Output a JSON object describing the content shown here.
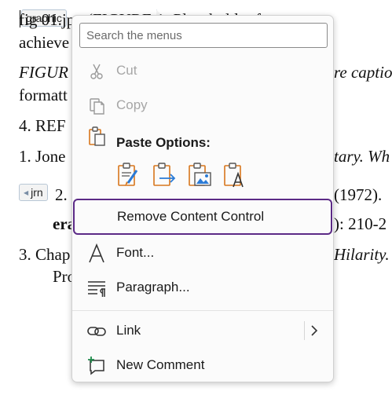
{
  "document": {
    "lines": [
      {
        "id": "l1",
        "text": "          fig 01.jpg  (FIGURE 1: Placeholder for",
        "style": "normal"
      },
      {
        "id": "l2",
        "text": "achieve",
        "style": "normal"
      },
      {
        "id": "l3",
        "text": "FIGUR",
        "style": "italic",
        "tail": "re captio"
      },
      {
        "id": "l4",
        "text": "formatt",
        "style": "normal"
      },
      {
        "id": "l5",
        "text": "4. REF",
        "style": "normal"
      },
      {
        "id": "l6",
        "text": "1. Jone",
        "style": "normal",
        "tail": "tary. Wh"
      },
      {
        "id": "l7",
        "text": "2.",
        "style": "normal",
        "tail": "(1972)."
      },
      {
        "id": "l8",
        "text": "era",
        "style": "bold",
        "tail": "): 210-2"
      },
      {
        "id": "l9",
        "text": "3. Chap",
        "style": "normal",
        "tail": "Hilarity."
      },
      {
        "id": "l10",
        "text": "Pro",
        "style": "normal"
      }
    ],
    "tags": {
      "graphic": "graphic",
      "jrn": "jrn"
    }
  },
  "menu": {
    "search_placeholder": "Search the menus",
    "cut_label": "Cut",
    "copy_label": "Copy",
    "paste_options_label": "Paste Options:",
    "remove_content_control_label": "Remove Content Control",
    "font_label": "Font...",
    "paragraph_label": "Paragraph...",
    "link_label": "Link",
    "new_comment_label": "New Comment"
  },
  "colors": {
    "focus_border": "#5b2a86",
    "icon_orange": "#d8761c",
    "icon_blue": "#2b7bd6",
    "disabled_text": "#a6a6a6"
  }
}
